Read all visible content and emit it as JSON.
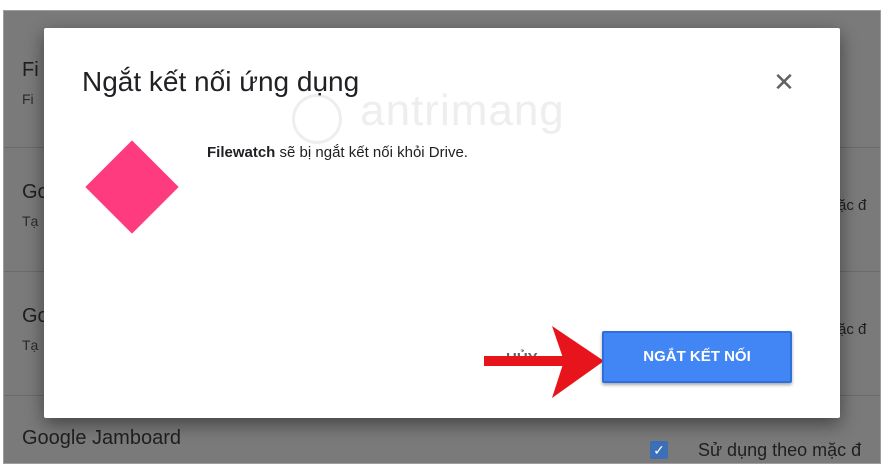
{
  "background": {
    "rows": [
      {
        "title": "Fi",
        "subtitle": "Fi",
        "right": ""
      },
      {
        "title": "Go",
        "subtitle": "Tạ",
        "right": "ặc đ"
      },
      {
        "title": "Go",
        "subtitle": "Tạ",
        "right": "ặc đ"
      }
    ],
    "jamboard": {
      "title": "Google Jamboard",
      "checkbox_label": "Sử dụng theo mặc đ",
      "checked": true
    }
  },
  "dialog": {
    "title": "Ngắt kết nối ứng dụng",
    "close_icon": "close-icon",
    "app_name": "Filewatch",
    "message": " sẽ bị ngắt kết nối khỏi Drive.",
    "cancel_label": "HỦY",
    "disconnect_label": "NGẮT KẾT NỐI",
    "app_icon_color": "#ff3b7f",
    "primary_color": "#4285f4",
    "watermark": "tantrimang"
  },
  "annotation": {
    "arrow_color": "#e8141c"
  }
}
